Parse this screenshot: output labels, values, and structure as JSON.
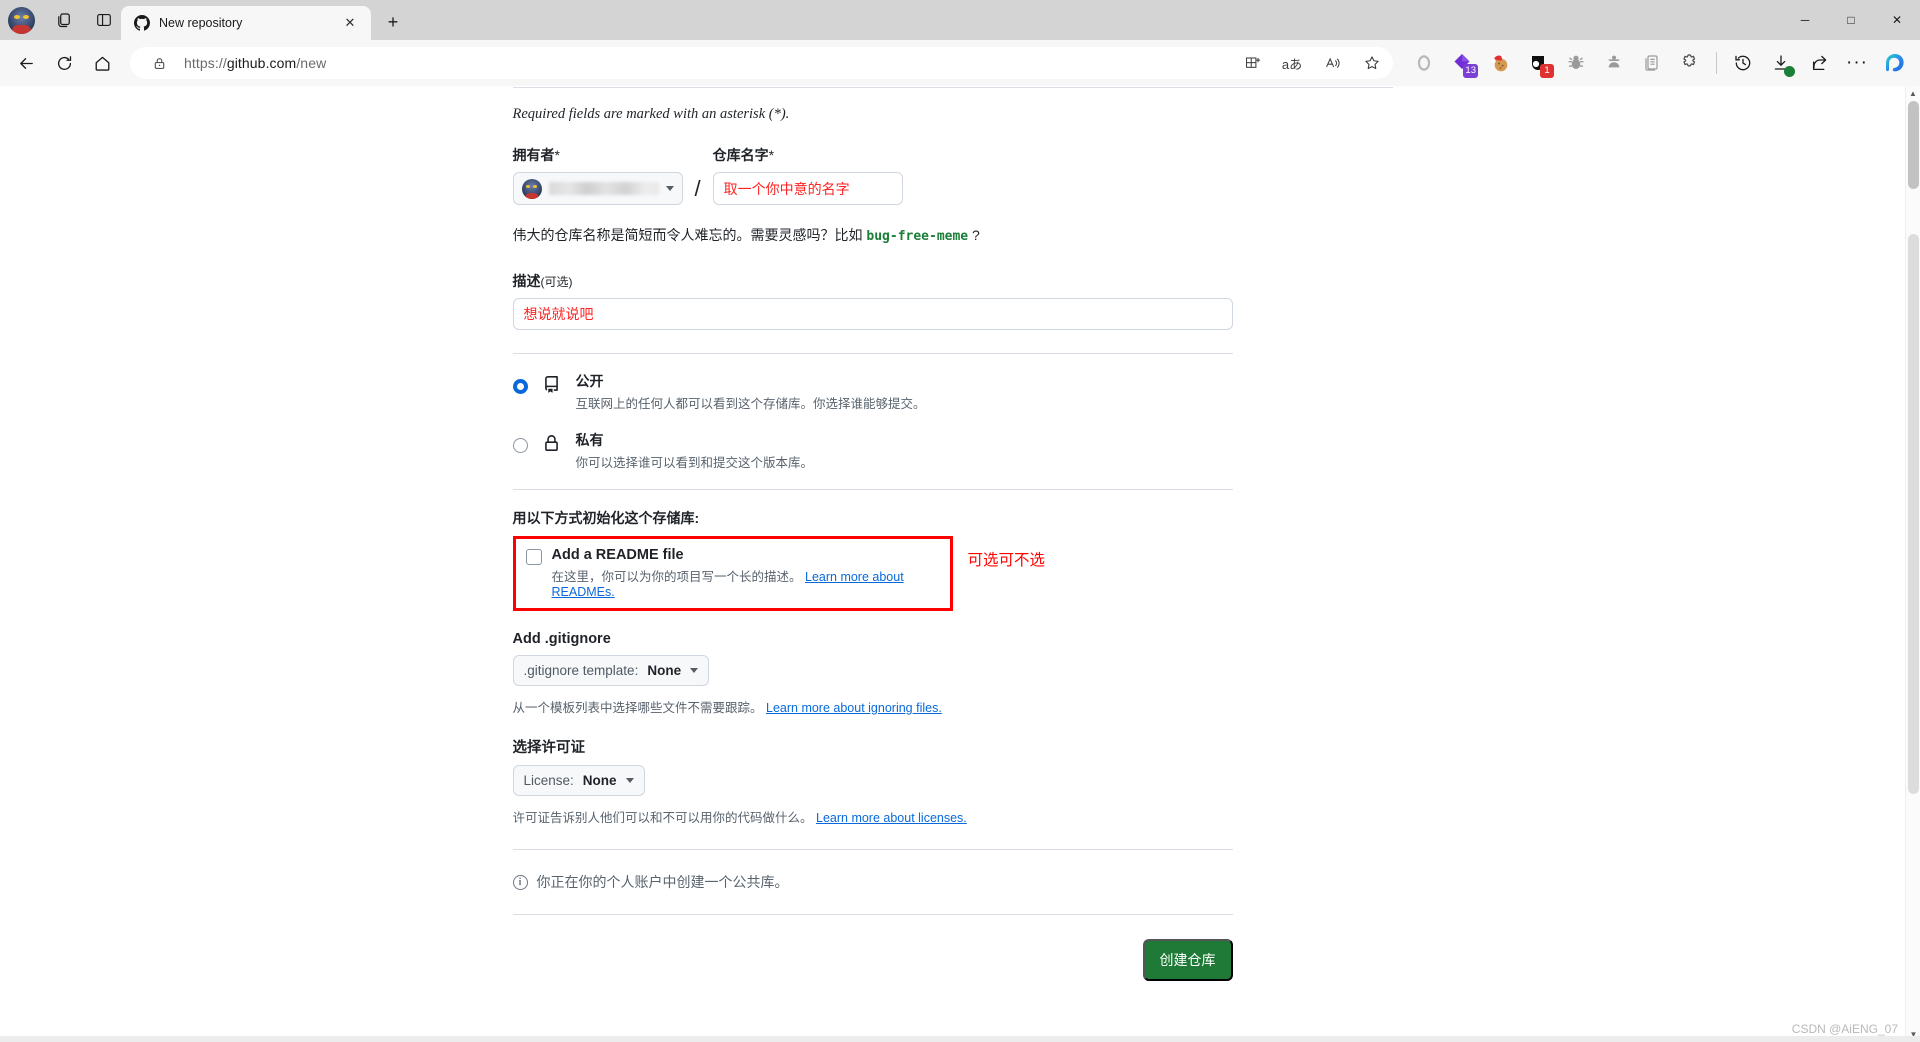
{
  "browser": {
    "tab": {
      "title": "New repository",
      "favicon": "github-icon",
      "close_label": "✕"
    },
    "newtab_label": "+",
    "address": {
      "url_prefix": "https://",
      "url_host": "github.com",
      "url_path": "/new",
      "lock_icon": "lock-icon"
    },
    "window_controls": {
      "minimize": "─",
      "maximize": "□",
      "close": "✕"
    },
    "toolbar_icons": [
      {
        "name": "back-icon"
      },
      {
        "name": "refresh-icon"
      },
      {
        "name": "home-icon"
      }
    ],
    "omnibox_icons": [
      {
        "name": "split-screen-icon"
      },
      {
        "name": "translate-icon"
      },
      {
        "name": "read-aloud-icon"
      },
      {
        "name": "favorite-star-icon"
      }
    ],
    "extensions": [
      {
        "name": "opera-ring-icon",
        "badge": ""
      },
      {
        "name": "purple-diamond-extension-icon",
        "badge": "13",
        "badge_color": "#7b3fd4"
      },
      {
        "name": "cookie-santa-extension-icon",
        "badge": ""
      },
      {
        "name": "black-capsule-extension-icon",
        "badge": "1",
        "badge_color": "#e03131"
      },
      {
        "name": "bug-extension-icon",
        "badge": ""
      },
      {
        "name": "agent-extension-icon",
        "badge": ""
      },
      {
        "name": "clipboard-extension-icon",
        "badge": ""
      },
      {
        "name": "puzzle-extensions-icon",
        "badge": ""
      }
    ],
    "right_icons": [
      {
        "name": "history-icon"
      },
      {
        "name": "downloads-complete-icon"
      },
      {
        "name": "share-icon"
      },
      {
        "name": "settings-more-icon"
      },
      {
        "name": "copilot-icon"
      }
    ]
  },
  "form": {
    "required_note": "Required fields are marked with an asterisk (*).",
    "owner": {
      "label": "拥有者",
      "asterisk": "*",
      "value": "",
      "caret": "chevron-down-icon"
    },
    "separator": "/",
    "repo_name": {
      "label": "仓库名字",
      "asterisk": "*",
      "value": "取一个你中意的名字"
    },
    "hint": {
      "prefix": "伟大的仓库名称是简短而令人难忘的。需要灵感吗？比如 ",
      "suggestion": "bug-free-meme",
      "suffix": " ?"
    },
    "description": {
      "label": "描述",
      "optional": "(可选)",
      "value": "想说就说吧"
    },
    "visibility": [
      {
        "icon": "repo-book-icon",
        "title": "公开",
        "desc": "互联网上的任何人都可以看到这个存储库。你选择谁能够提交。",
        "checked": true
      },
      {
        "icon": "lock-icon",
        "title": "私有",
        "desc": "你可以选择谁可以看到和提交这个版本库。",
        "checked": false
      }
    ],
    "initialize": {
      "title": "用以下方式初始化这个存储库:",
      "readme": {
        "checked": false,
        "title": "Add a README file",
        "desc": "在这里，你可以为你的项目写一个长的描述。",
        "link": "Learn more about READMEs."
      },
      "annotation": "可选可不选",
      "annotation_color": "#ff0000"
    },
    "gitignore": {
      "title": "Add .gitignore",
      "dropdown_label": ".gitignore template:",
      "dropdown_value": "None",
      "help_text": "从一个模板列表中选择哪些文件不需要跟踪。",
      "help_link": "Learn more about ignoring files."
    },
    "license": {
      "title": "选择许可证",
      "dropdown_label": "License:",
      "dropdown_value": "None",
      "help_text": "许可证告诉别人他们可以和不可以用你的代码做什么。",
      "help_link": "Learn more about licenses."
    },
    "notice": {
      "icon": "info-icon",
      "text": "你正在你的个人账户中创建一个公共库。"
    },
    "submit": {
      "label": "创建仓库",
      "color": "#1f7a37"
    }
  },
  "watermark": "CSDN @AiENG_07"
}
